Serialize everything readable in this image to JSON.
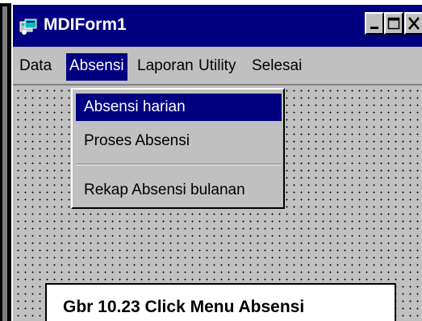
{
  "window": {
    "title": "MDIForm1",
    "controls": {
      "minimize_icon": "minimize-icon",
      "maximize_icon": "maximize-icon",
      "close_icon": "close-icon"
    }
  },
  "menubar": {
    "items": [
      {
        "label": "Data",
        "active": false
      },
      {
        "label": "Absensi",
        "active": true
      },
      {
        "label": "Laporan",
        "active": false
      },
      {
        "label": "Utility",
        "active": false
      },
      {
        "label": "Selesai",
        "active": false
      }
    ]
  },
  "dropdown": {
    "items": [
      {
        "label": "Absensi harian",
        "highlighted": true
      },
      {
        "label": "Proses Absensi",
        "highlighted": false
      },
      {
        "label": "Rekap Absensi bulanan",
        "highlighted": false
      }
    ]
  },
  "caption": {
    "text": "Gbr 10.23  Click Menu Absensi"
  },
  "colors": {
    "titlebar": "#000080",
    "highlight": "#000080",
    "face": "#c0c0c0"
  }
}
